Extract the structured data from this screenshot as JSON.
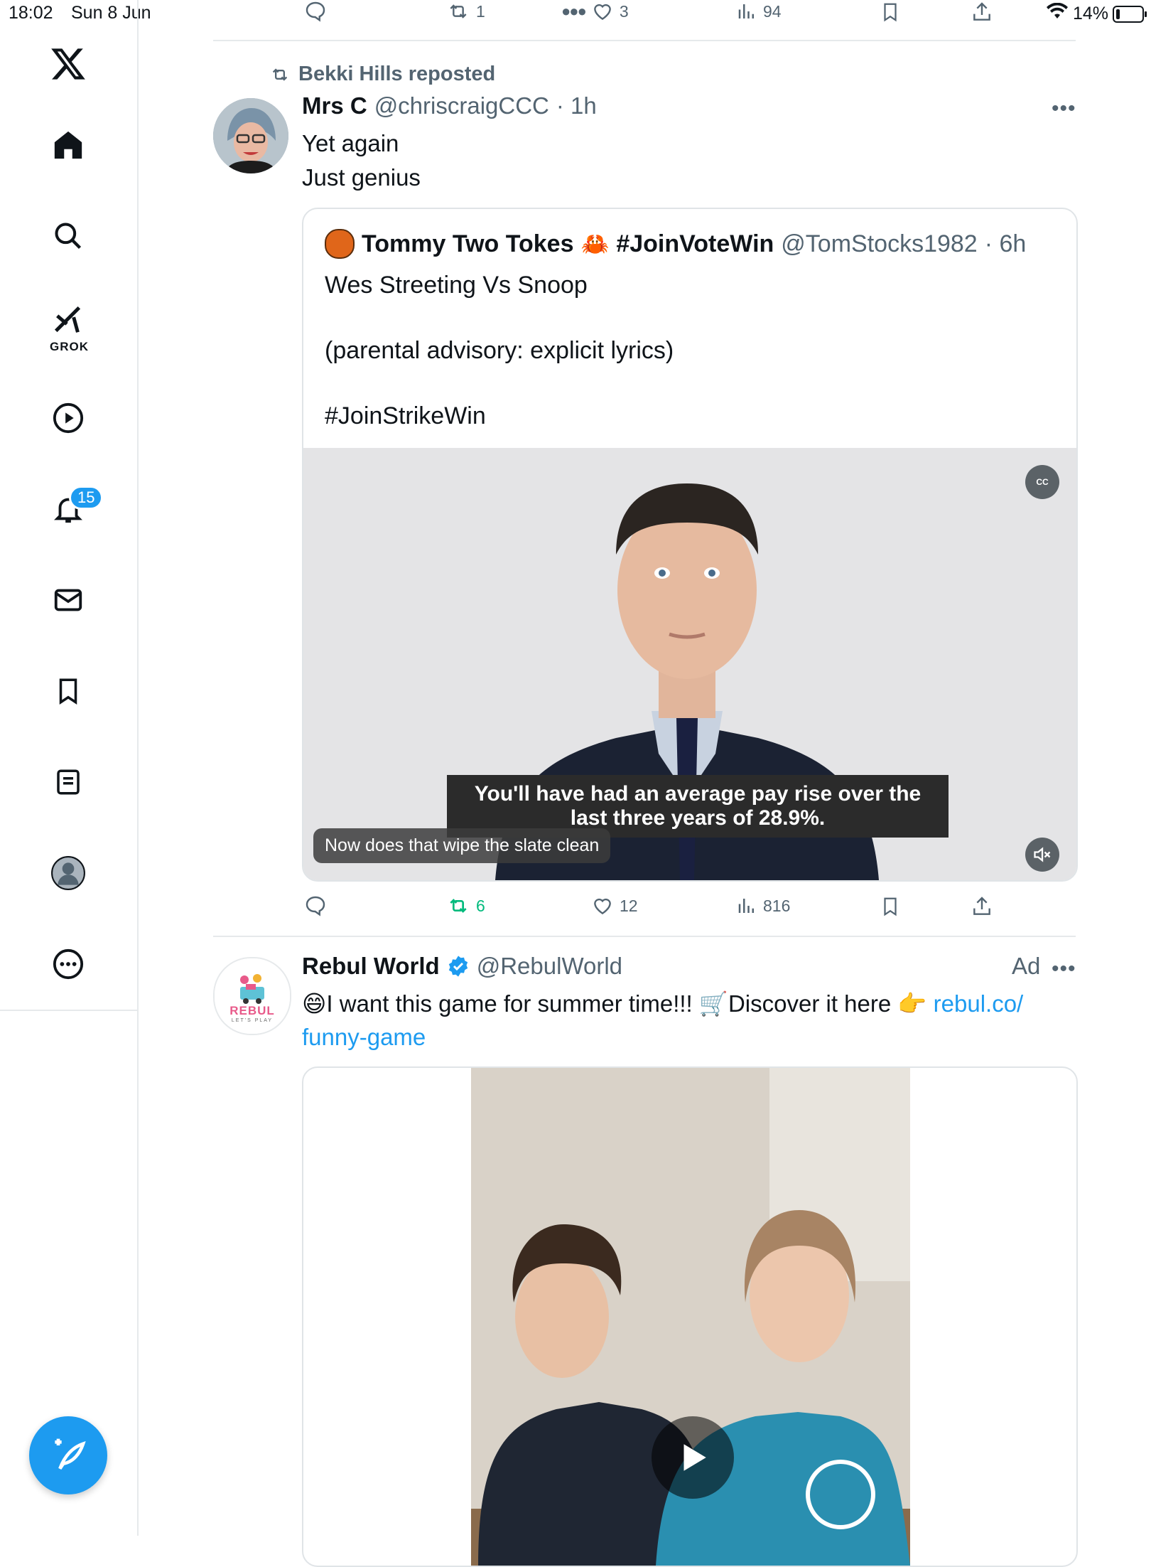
{
  "status": {
    "time": "18:02",
    "date": "Sun 8 Jun",
    "battery": "14%"
  },
  "top_actions": {
    "reposts": "1",
    "likes": "3",
    "views": "94"
  },
  "sidebar": {
    "grok_label": "GROK",
    "notifications_count": "15",
    "items": [
      "home",
      "search",
      "grok",
      "videos",
      "notifications",
      "messages",
      "bookmarks",
      "lists",
      "profile",
      "more"
    ]
  },
  "tweet": {
    "reposted_by": "Bekki Hills reposted",
    "name": "Mrs C",
    "handle": "@chriscraigCCC",
    "time": "· 1h",
    "line1": "Yet again",
    "line2": "Just genius",
    "quote": {
      "name": "Tommy Two Tokes",
      "emoji": "🦀",
      "hashtag_name": "#JoinVoteWin",
      "handle": "@TomStocks1982",
      "time": "· 6h",
      "line1": "Wes Streeting Vs Snoop",
      "line2": "(parental advisory: explicit lyrics)",
      "line3": "#JoinStrikeWin",
      "subtitle": "You'll have had an average pay rise over the last three years of 28.9%.",
      "caption": "Now does that wipe the slate clean",
      "cc_label": "CC"
    },
    "actions": {
      "reposts": "6",
      "likes": "12",
      "views": "816"
    }
  },
  "ad": {
    "name": "Rebul World",
    "handle": "@RebulWorld",
    "ad_label": "Ad",
    "text_pre": "😄I want this game for summer time!!! 🛒Discover it here 👉 ",
    "link_a": "rebul.co/",
    "link_b": "funny-game",
    "logo_text": "REBUL",
    "logo_sub": "LET'S PLAY"
  },
  "colors": {
    "accent": "#1d9bf0",
    "repost_green": "#00ba7c",
    "muted": "#536471"
  }
}
